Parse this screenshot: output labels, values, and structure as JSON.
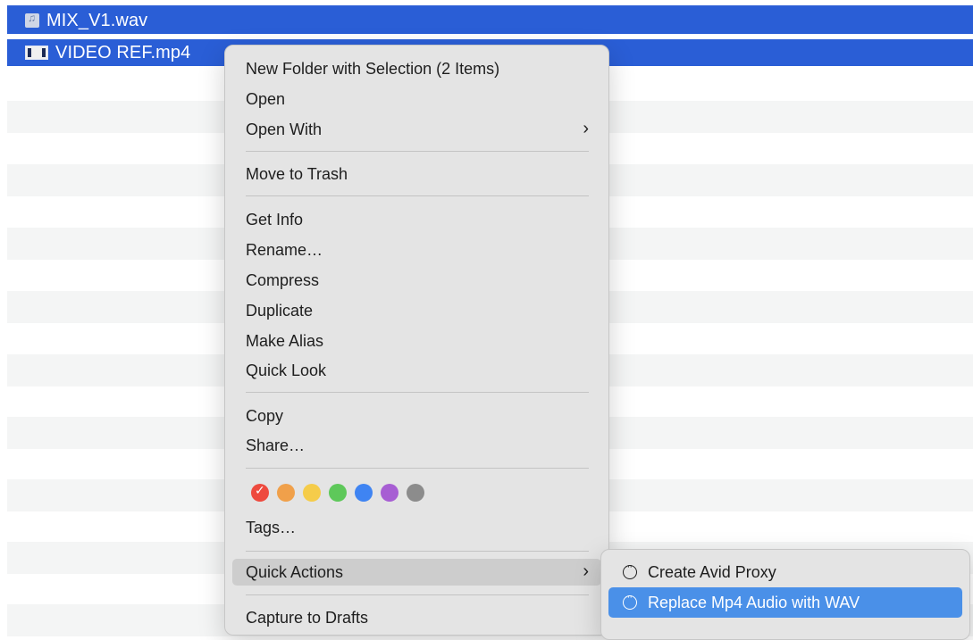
{
  "files": [
    {
      "name": "MIX_V1.wav",
      "icon": "audio-file-icon"
    },
    {
      "name": "VIDEO REF.mp4",
      "icon": "video-file-icon"
    }
  ],
  "colors": {
    "selection": "#2a5ed6",
    "menu_bg": "#e4e4e4",
    "submenu_active": "#4a90e8"
  },
  "context_menu": {
    "new_folder": "New Folder with Selection (2 Items)",
    "open": "Open",
    "open_with": "Open With",
    "move_to_trash": "Move to Trash",
    "get_info": "Get Info",
    "rename": "Rename…",
    "compress": "Compress",
    "duplicate": "Duplicate",
    "make_alias": "Make Alias",
    "quick_look": "Quick Look",
    "copy": "Copy",
    "share": "Share…",
    "tags_label": "Tags…",
    "quick_actions": "Quick Actions",
    "capture_to_drafts": "Capture to Drafts",
    "tag_colors": [
      {
        "name": "red",
        "color": "#ee4a3e",
        "selected": true
      },
      {
        "name": "orange",
        "color": "#f0a04a"
      },
      {
        "name": "yellow",
        "color": "#f5cc4a"
      },
      {
        "name": "green",
        "color": "#5ec85a"
      },
      {
        "name": "blue",
        "color": "#3f84f2"
      },
      {
        "name": "purple",
        "color": "#a75ed3"
      },
      {
        "name": "gray",
        "color": "#8c8c8c"
      }
    ]
  },
  "quick_actions_submenu": {
    "create_avid_proxy": "Create Avid Proxy",
    "replace_audio": "Replace Mp4 Audio with WAV"
  }
}
